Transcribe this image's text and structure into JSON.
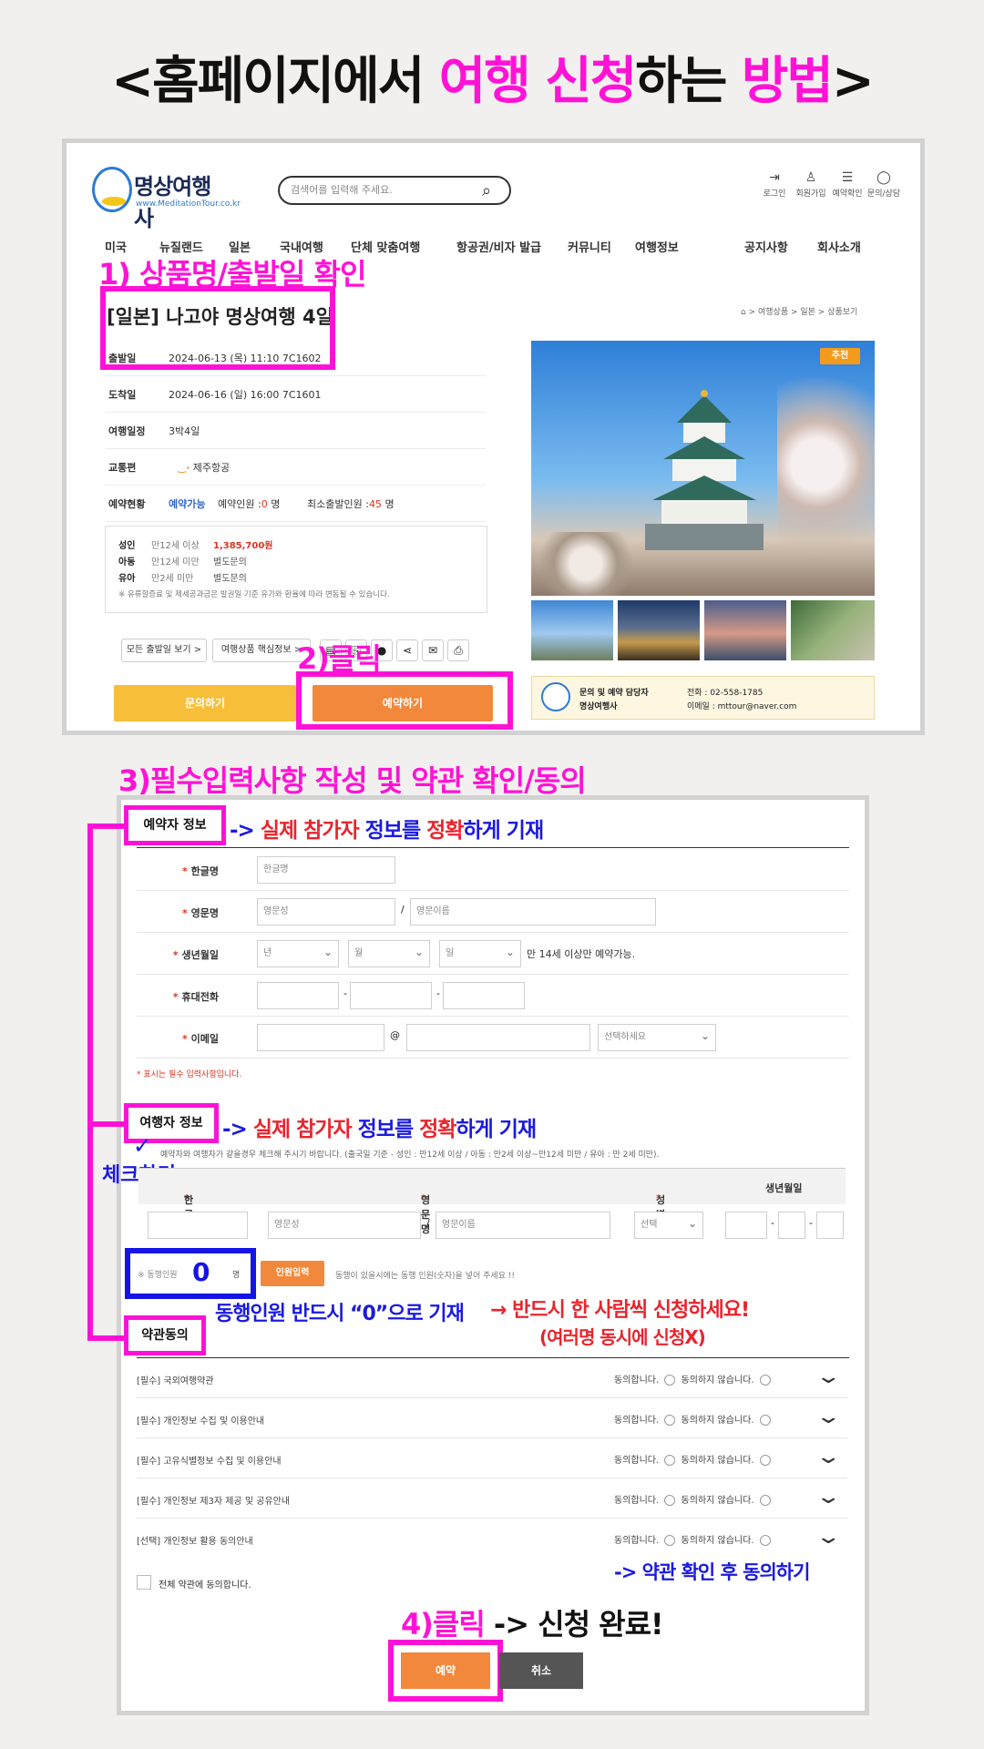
{
  "guide_title": {
    "prefix": "<홈페이지에서 ",
    "highlight1": "여행 신청",
    "middle": "하는 ",
    "highlight2": "방법",
    "suffix": ">"
  },
  "steps": {
    "step1": "1) 상품명/출발일 확인",
    "step2": "2)클릭",
    "step3": "3)필수입력사항 작성 및 약관 확인/동의",
    "step4_part1": "4)클릭",
    "step4_part2": "-> 신청 완료!"
  },
  "site": {
    "logo_name": "명상여행사",
    "logo_url": "www.MeditationTour.co.kr",
    "search_placeholder": "검색어를 입력해 주세요.",
    "top_links": [
      {
        "label": "로그인",
        "icon": "login-icon"
      },
      {
        "label": "회원가입",
        "icon": "user-icon"
      },
      {
        "label": "예약확인",
        "icon": "list-icon"
      },
      {
        "label": "문의/상담",
        "icon": "chat-icon"
      }
    ],
    "menu": [
      "미국",
      "뉴질랜드",
      "일본",
      "국내여행",
      "단체 맞춤여행",
      "항공권/비자 발급",
      "커뮤니티",
      "여행정보",
      "공지사항",
      "회사소개"
    ]
  },
  "product": {
    "title": "[일본] 나고야 명상여행 4일",
    "breadcrumb": [
      "여행상품",
      "일본",
      "상품보기"
    ],
    "rows": [
      {
        "label": "출발일",
        "value": "2024-06-13 (목) 11:10 7C1602"
      },
      {
        "label": "도착일",
        "value": "2024-06-16 (일) 16:00 7C1601"
      },
      {
        "label": "여행일정",
        "value": "3박4일"
      },
      {
        "label": "교통편",
        "value": "제주항공"
      }
    ],
    "status_label": "예약현황",
    "status_value": "예약가능",
    "reserved_label": "예약인원 :",
    "reserved_count": "0",
    "min_label": "최소출발인원 :",
    "min_count": "45",
    "unit": "명",
    "prices": [
      {
        "type": "성인",
        "age": "만12세 이상",
        "price": "1,385,700원"
      },
      {
        "type": "아동",
        "age": "만12세 미만",
        "price": "별도문의"
      },
      {
        "type": "유아",
        "age": "만2세 미만",
        "price": "별도문의"
      }
    ],
    "price_note": "※ 유류할증료 및 제세공과금은 발권일 기준 유가와 환율에 따라 변동될 수 있습니다.",
    "btn_all_dates": "모든 출발일 보기 >",
    "btn_core_info": "여행상품 핵심정보 >",
    "btn_inquiry": "문의하기",
    "btn_reserve": "예약하기",
    "badge": "추천",
    "contact_title": "문의 및 예약 담당자",
    "contact_company": "명상여행사",
    "contact_phone": "전화 : 02-558-1785",
    "contact_email": "이메일 : mttour@naver.com"
  },
  "booker": {
    "section": "예약자 정보",
    "annotation": {
      "p1": "-> ",
      "p2": "실제 참가자",
      "p3": " 정보를 ",
      "p4": "정확",
      "p5": "하게 기재"
    },
    "fields": {
      "korean_name_label": "한글명",
      "korean_name_placeholder": "한글명",
      "english_name_label": "영문명",
      "last_name_placeholder": "영문성",
      "first_name_placeholder": "영문이름",
      "birth_label": "생년월일",
      "year": "년",
      "month": "월",
      "day": "일",
      "birth_note": "만 14세 이상만 예약가능.",
      "phone_label": "휴대전화",
      "email_label": "이메일",
      "email_select": "선택하세요"
    },
    "required_note": "* 표시는 필수 입력사항입니다."
  },
  "traveler": {
    "section": "여행자 정보",
    "annotation": {
      "p1": "-> ",
      "p2": "실제 참가자",
      "p3": " 정보를 ",
      "p4": "정확",
      "p5": "하게 기재"
    },
    "check_note": "체크하기",
    "same_note": "예약자와 여행자가 같을경우 체크해 주시기 바랍니다. (출국일 기준 - 성인 : 만12세 이상 / 아동 : 만2세 이상~만12세 미만 / 유아 : 만 2세 미만).",
    "headers": [
      "한글명",
      "영문명",
      "성별",
      "생년월일"
    ],
    "last_name_placeholder": "영문성",
    "first_name_placeholder": "영문이름",
    "gender_select": "선택",
    "companion_label": "※ 동행인원",
    "companion_value": "0",
    "companion_unit": "명",
    "companion_button": "인원입력",
    "companion_help": "동행이 있을시에는 동행 인원(숫자)을 넣어 주세요 !!",
    "companion_note1": "동행인원 반드시 “0”으로 기재",
    "companion_note2": "→ 반드시 한 사람씩 신청하세요!",
    "companion_note3": "(여러명 동시에 신청X)"
  },
  "terms": {
    "section": "약관동의",
    "agree": "동의합니다.",
    "disagree": "동의하지 않습니다.",
    "items": [
      "[필수] 국외여행약관",
      "[필수] 개인정보 수집 및 이용안내",
      "[필수] 고유식별정보 수집 및 이용안내",
      "[필수] 개인정보 제3자 제공 및 공유안내",
      "[선택] 개인정보 활용 동의안내"
    ],
    "agree_all": "전체 약관에 동의합니다.",
    "confirm_note": "-> 약관 확인 후 동의하기"
  },
  "actions": {
    "submit": "예약",
    "cancel": "취소"
  },
  "colors": {
    "highlight": "#ff12d6",
    "annotation_blue": "#1414e6",
    "annotation_red": "#e8252d",
    "reserve_orange": "#f2883b",
    "inquiry_yellow": "#f7be3a"
  }
}
